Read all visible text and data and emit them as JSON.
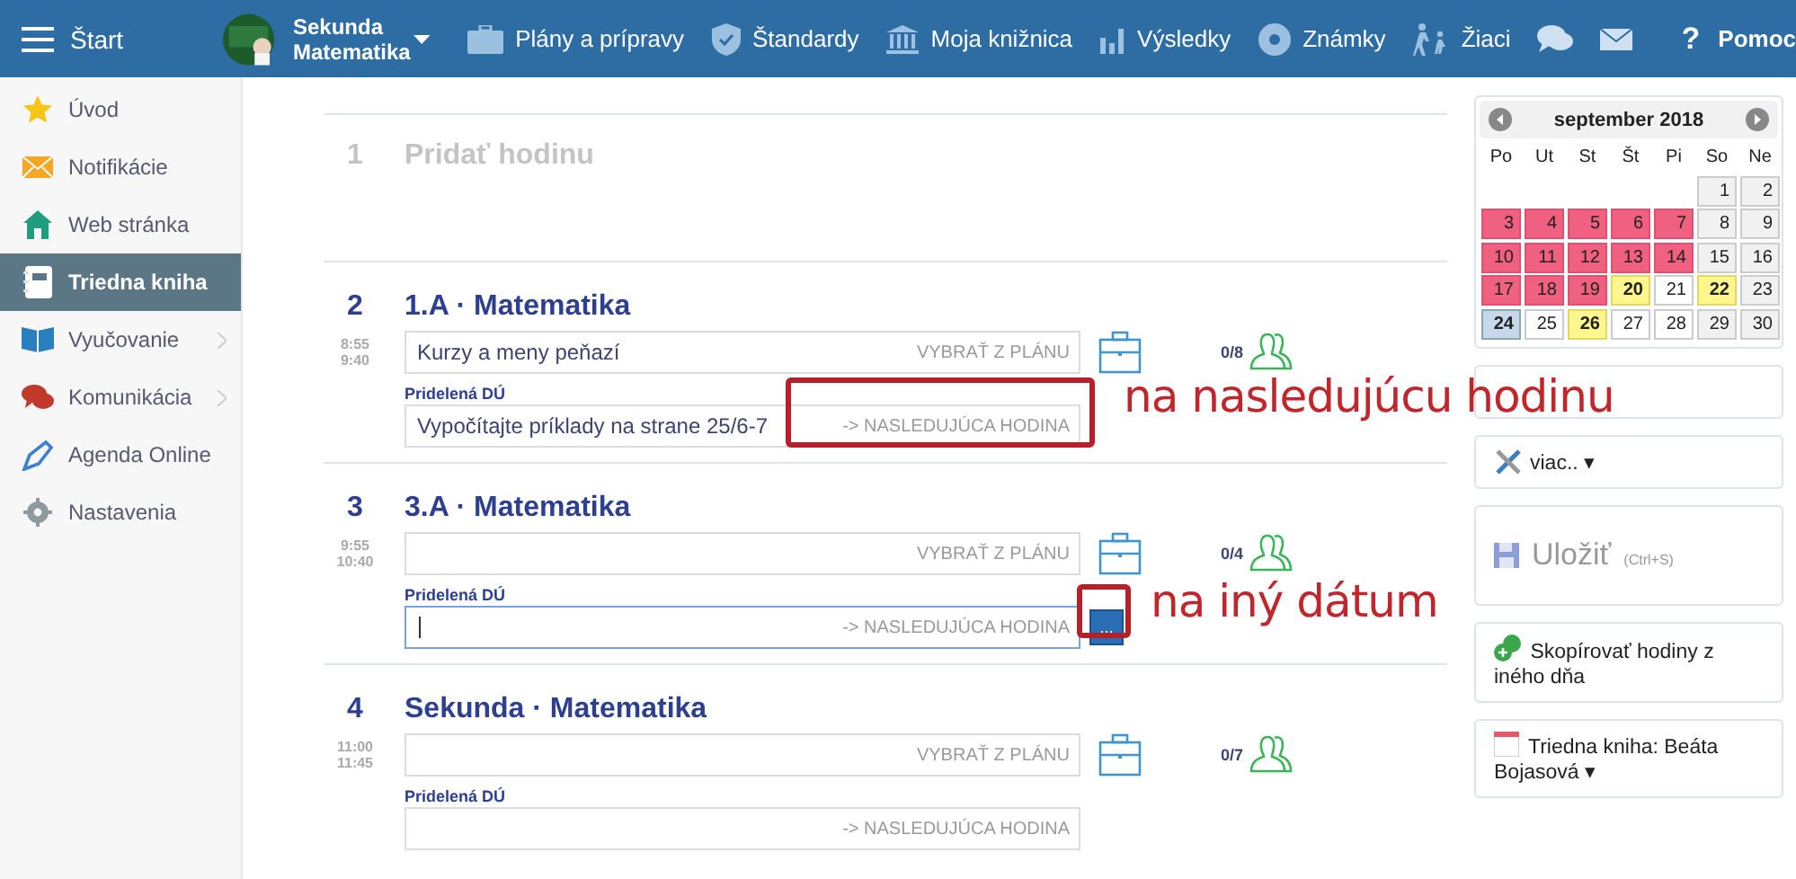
{
  "topbar": {
    "start": "Štart",
    "class_name": "Sekunda Matematika",
    "nav": [
      {
        "kind": "briefcase",
        "label": "Plány a prípravy"
      },
      {
        "kind": "shield",
        "label": "Štandardy"
      },
      {
        "kind": "bank",
        "label": "Moja knižnica"
      },
      {
        "kind": "bars",
        "label": "Výsledky"
      },
      {
        "kind": "badge",
        "label": "Známky"
      },
      {
        "kind": "walkers",
        "label": "Žiaci"
      },
      {
        "kind": "chat"
      },
      {
        "kind": "mail"
      }
    ],
    "help_mark": "?",
    "help": "Pomoc"
  },
  "sidebar": {
    "items": [
      {
        "kind": "star",
        "label": "Úvod",
        "selected": false,
        "submenu": false
      },
      {
        "kind": "envelope",
        "label": "Notifikácie",
        "selected": false,
        "submenu": false
      },
      {
        "kind": "house",
        "label": "Web stránka",
        "selected": false,
        "submenu": false
      },
      {
        "kind": "notebook",
        "label": "Triedna kniha",
        "selected": true,
        "submenu": false
      },
      {
        "kind": "book",
        "label": "Vyučovanie",
        "selected": false,
        "submenu": true
      },
      {
        "kind": "speech",
        "label": "Komunikácia",
        "selected": false,
        "submenu": true
      },
      {
        "kind": "pen",
        "label": "Agenda Online",
        "selected": false,
        "submenu": false
      },
      {
        "kind": "gear",
        "label": "Nastavenia",
        "selected": false,
        "submenu": false
      }
    ]
  },
  "lessons": [
    {
      "kind": "add",
      "number": "1",
      "title": "Pridať hodinu"
    },
    {
      "kind": "lesson",
      "number": "2",
      "title": "1.A · Matematika",
      "start": "8:55",
      "end": "9:40",
      "topic": "Kurzy a meny peňazí",
      "plan_button": "VYBRAŤ Z PLÁNU",
      "attendance": "0/8",
      "homework_label": "Pridelená DÚ",
      "homework": "Vypočítajte príklady na strane 25/6-7",
      "next_button": "-> NASLEDUJÚCA HODINA",
      "focused": false
    },
    {
      "kind": "lesson",
      "number": "3",
      "title": "3.A · Matematika",
      "start": "9:55",
      "end": "10:40",
      "plan_button": "VYBRAŤ Z PLÁNU",
      "attendance": "0/4",
      "homework_label": "Pridelená DÚ",
      "next_button": "-> NASLEDUJÚCA HODINA",
      "focused": true,
      "date_button": "..."
    },
    {
      "kind": "lesson",
      "number": "4",
      "title": "Sekunda · Matematika",
      "start": "11:00",
      "end": "11:45",
      "plan_button": "VYBRAŤ Z PLÁNU",
      "attendance": "0/7",
      "homework_label": "Pridelená DÚ",
      "next_button": "-> NASLEDUJÚCA HODINA",
      "focused": false
    }
  ],
  "calendar": {
    "month": "september 2018",
    "weekdays": [
      "Po",
      "Ut",
      "St",
      "Št",
      "Pi",
      "So",
      "Ne"
    ],
    "weeks": [
      [
        {
          "kind": "empty"
        },
        {
          "kind": "empty"
        },
        {
          "kind": "empty"
        },
        {
          "kind": "empty"
        },
        {
          "kind": "empty"
        },
        {
          "kind": "weekend",
          "day": "1"
        },
        {
          "kind": "weekend",
          "day": "2"
        }
      ],
      [
        {
          "kind": "lesson",
          "day": "3"
        },
        {
          "kind": "lesson",
          "day": "4"
        },
        {
          "kind": "lesson",
          "day": "5"
        },
        {
          "kind": "lesson",
          "day": "6"
        },
        {
          "kind": "lesson",
          "day": "7"
        },
        {
          "kind": "weekend",
          "day": "8"
        },
        {
          "kind": "weekend",
          "day": "9"
        }
      ],
      [
        {
          "kind": "lesson",
          "day": "10"
        },
        {
          "kind": "lesson",
          "day": "11"
        },
        {
          "kind": "lesson",
          "day": "12"
        },
        {
          "kind": "lesson",
          "day": "13"
        },
        {
          "kind": "lesson",
          "day": "14"
        },
        {
          "kind": "weekend",
          "day": "15"
        },
        {
          "kind": "weekend",
          "day": "16"
        }
      ],
      [
        {
          "kind": "lesson",
          "day": "17"
        },
        {
          "kind": "lesson",
          "day": "18"
        },
        {
          "kind": "lesson",
          "day": "19"
        },
        {
          "kind": "marked",
          "day": "20"
        },
        {
          "kind": "plain",
          "day": "21"
        },
        {
          "kind": "marked",
          "day": "22"
        },
        {
          "kind": "weekend",
          "day": "23"
        }
      ],
      [
        {
          "kind": "today",
          "day": "24"
        },
        {
          "kind": "plain",
          "day": "25"
        },
        {
          "kind": "marked",
          "day": "26"
        },
        {
          "kind": "plain",
          "day": "27"
        },
        {
          "kind": "plain",
          "day": "28"
        },
        {
          "kind": "weekend",
          "day": "29"
        },
        {
          "kind": "weekend",
          "day": "30"
        }
      ]
    ]
  },
  "actions": [
    {
      "kind": "blank"
    },
    {
      "kind": "more",
      "label": "viac..",
      "caret": "▾"
    },
    {
      "kind": "save",
      "label": "Uložiť",
      "hint": "(Ctrl+S)",
      "disabled": true
    },
    {
      "kind": "copy",
      "label": "Skopírovať hodiny z iného dňa"
    },
    {
      "kind": "owner",
      "label": "Triedna kniha: Beáta Bojasová",
      "caret": "▾"
    }
  ],
  "annotations": [
    {
      "text": "na nasledujúcu hodinu"
    },
    {
      "text": "na iný dátum"
    }
  ]
}
